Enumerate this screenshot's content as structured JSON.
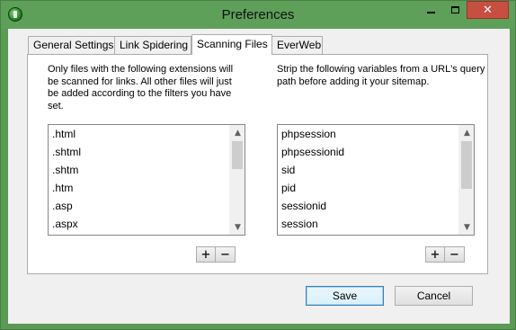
{
  "window": {
    "title": "Preferences",
    "controls": {
      "minimize": "minimize",
      "maximize": "maximize",
      "close": "✕"
    }
  },
  "tabs": [
    {
      "label": "General Settings",
      "active": false
    },
    {
      "label": "Link Spidering",
      "active": false
    },
    {
      "label": "Scanning Files",
      "active": true
    },
    {
      "label": "EverWeb",
      "active": false
    }
  ],
  "left": {
    "description": "Only files with the following extensions will be scanned for links. All other files will just be added according to the filters you have set.",
    "items": [
      ".html",
      ".shtml",
      ".shtm",
      ".htm",
      ".asp",
      ".aspx"
    ],
    "add_label": "+",
    "remove_label": "−"
  },
  "right": {
    "description": "Strip the following variables from a URL's query path before adding it your sitemap.",
    "items": [
      "phpsession",
      "phpsessionid",
      "sid",
      "pid",
      "sessionid",
      "session"
    ],
    "add_label": "+",
    "remove_label": "−"
  },
  "buttons": {
    "save": "Save",
    "cancel": "Cancel"
  },
  "colors": {
    "titlebar": "#5e9f59",
    "close": "#c74f41",
    "default_button_border": "#3c7fb1"
  }
}
